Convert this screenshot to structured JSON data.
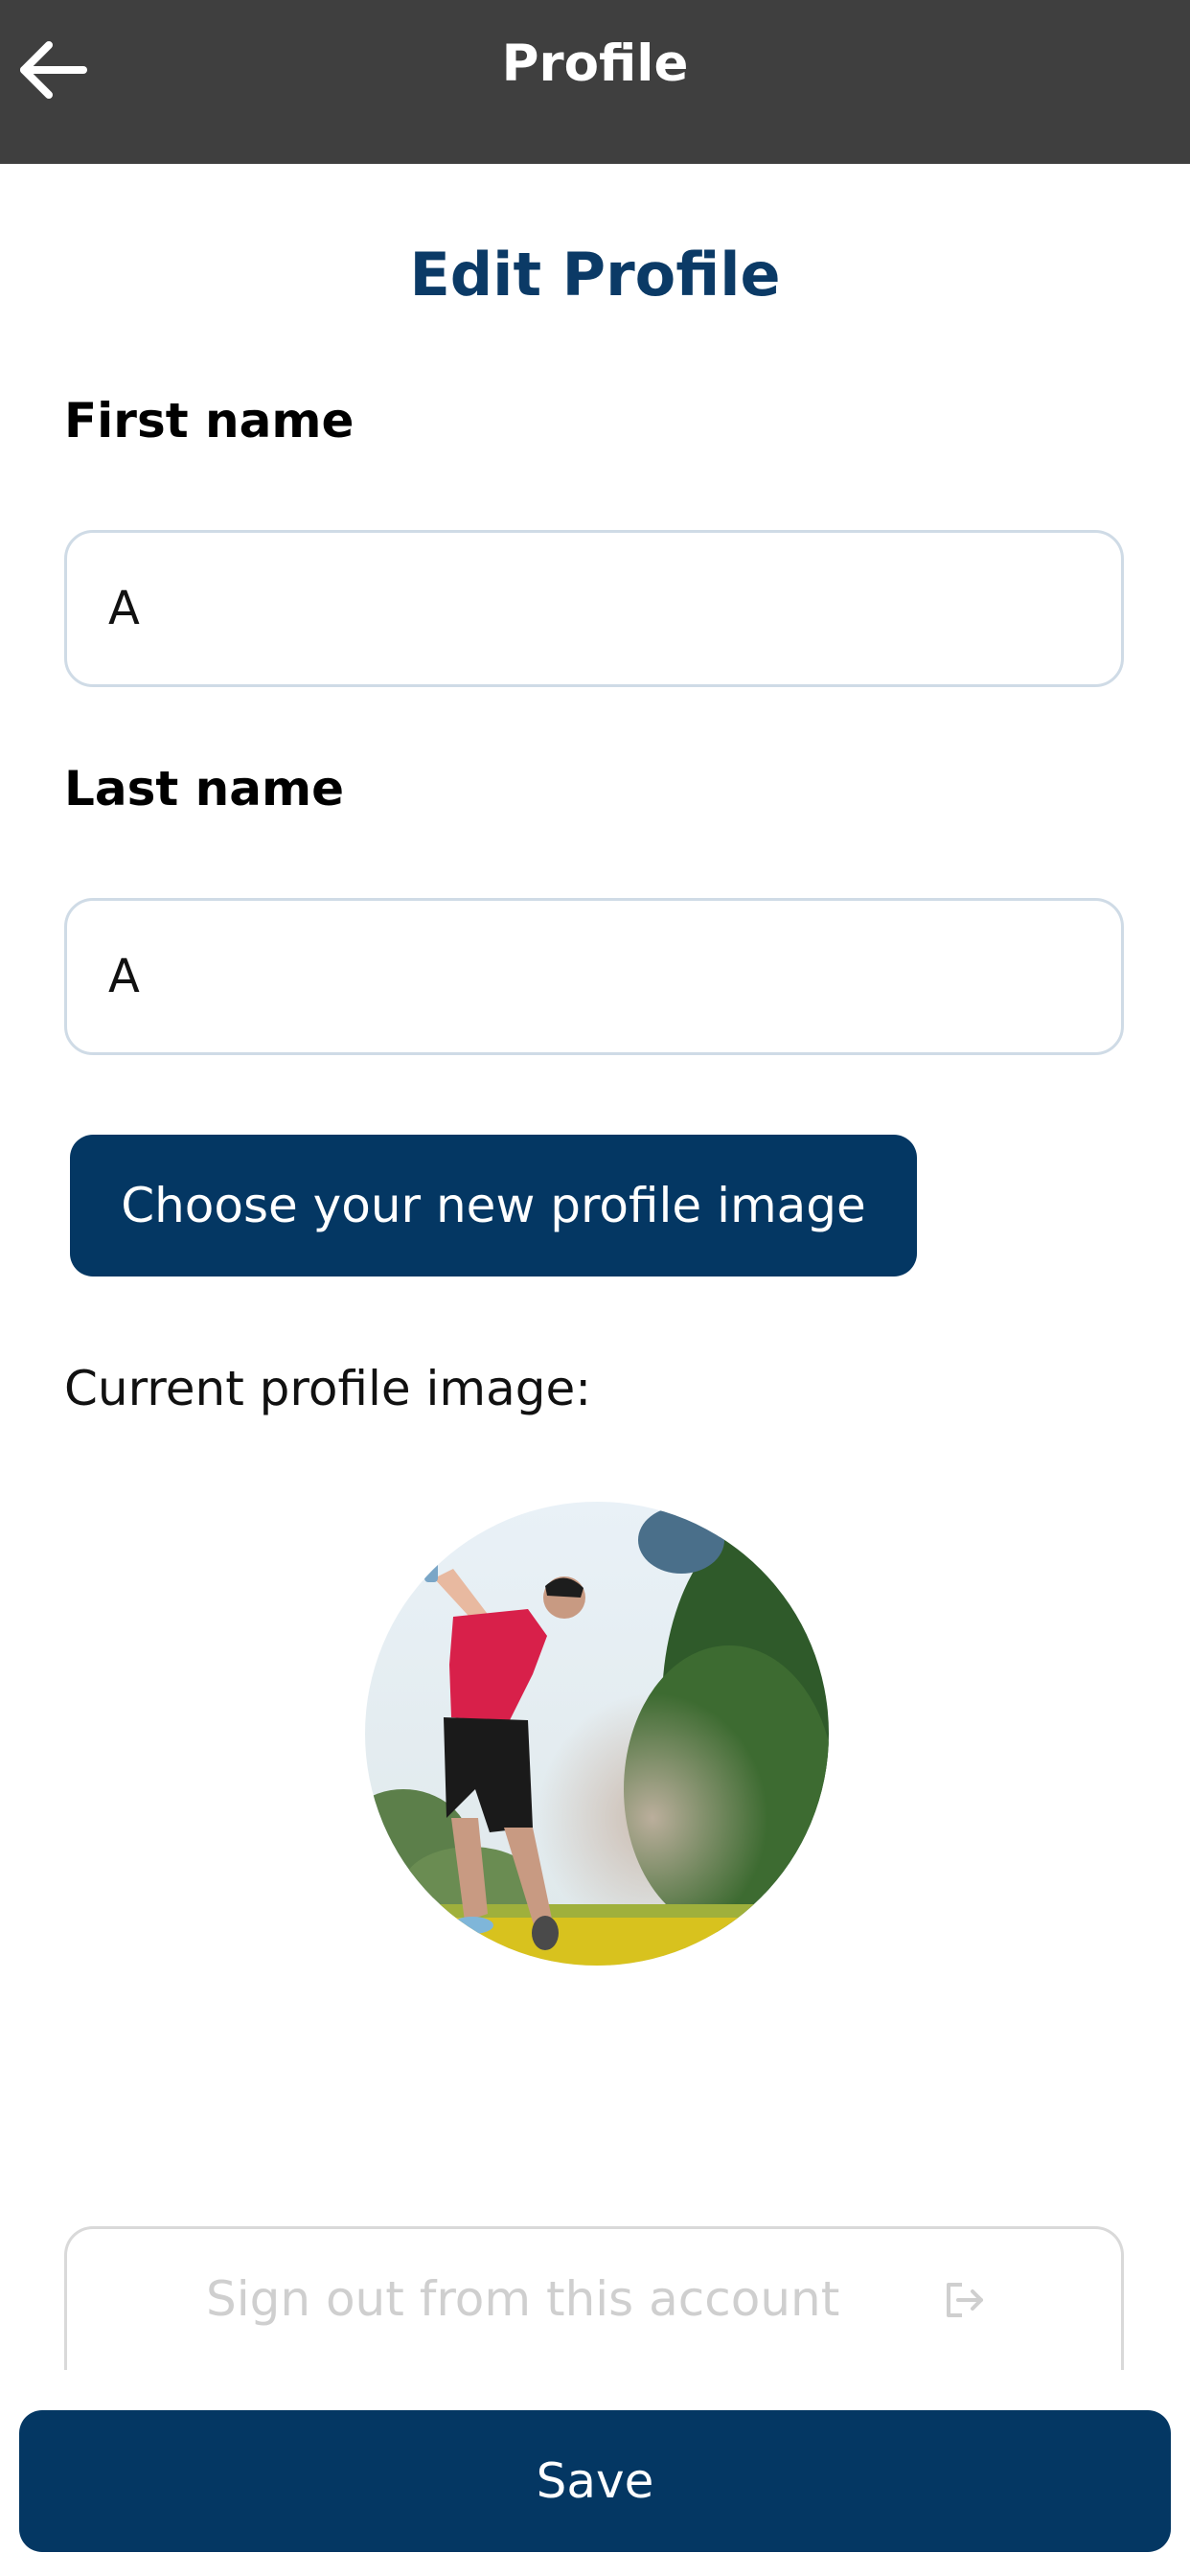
{
  "app_bar": {
    "title": "Profile",
    "back_icon": "arrow-left-icon"
  },
  "heading": "Edit Profile",
  "form": {
    "first_name": {
      "label": "First name",
      "value": "A"
    },
    "last_name": {
      "label": "Last name",
      "value": "A"
    }
  },
  "choose_image_label": "Choose your new profile image",
  "current_image_label": "Current profile image:",
  "signout": {
    "label": "Sign out from this account",
    "icon": "logout-icon"
  },
  "save_label": "Save",
  "colors": {
    "app_bar": "#3f3f3f",
    "primary": "#043763",
    "heading": "#0b3a66"
  }
}
